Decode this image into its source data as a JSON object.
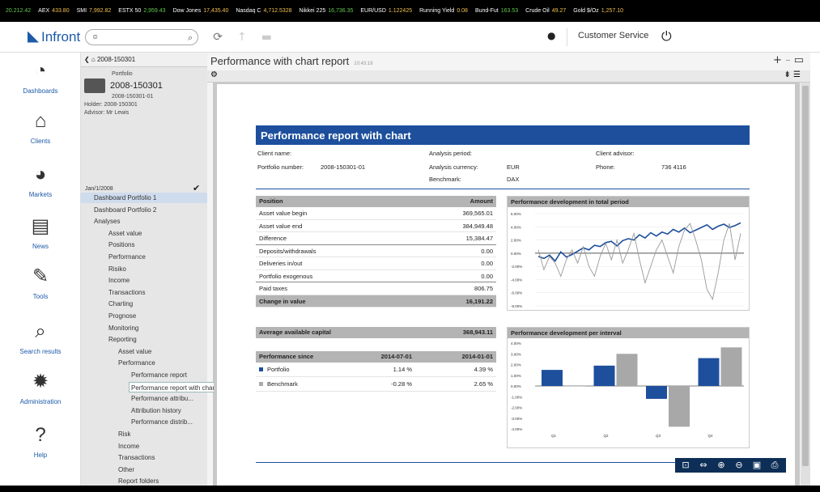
{
  "ticker": [
    {
      "name": "",
      "value": "20.212.42"
    },
    {
      "name": "AEX",
      "value": "433.80"
    },
    {
      "name": "SMI",
      "value": "7,992.82"
    },
    {
      "name": "ESTX 50",
      "value": "2,959.43"
    },
    {
      "name": "Dow Jones",
      "value": "17,435.40"
    },
    {
      "name": "Nasdaq C",
      "value": "4,712.5328"
    },
    {
      "name": "Nikkei 225",
      "value": "16,736.35"
    },
    {
      "name": "EUR/USD",
      "value": "1.122425"
    },
    {
      "name": "Running Yield",
      "value": "0.08"
    },
    {
      "name": "Bund-Fut",
      "value": "163.53"
    },
    {
      "name": "Crude Oil",
      "value": "49.27"
    },
    {
      "name": "Gold $/Oz",
      "value": "1,257.10"
    }
  ],
  "header": {
    "brand": "Infront",
    "search_placeholder": "",
    "customer_service": "Customer Service"
  },
  "rail": [
    "Dashboards",
    "Clients",
    "Markets",
    "News",
    "Tools",
    "Search results",
    "Administration",
    "Help"
  ],
  "tree": {
    "back_label": "2008-150301",
    "portfolio_label": "Portfolio",
    "portfolio_name": "2008-150301",
    "portfolio_id": "2008-150301-01",
    "holder": "Holder: 2008-150301",
    "advisor": "Advisor: Mr Lewis",
    "date": "Jan/1/2008",
    "nodes": [
      {
        "label": "Dashboard Portfolio 1",
        "indent": 16,
        "sel": true
      },
      {
        "label": "Dashboard Portfolio 2",
        "indent": 16
      },
      {
        "label": "Analyses",
        "indent": 16
      },
      {
        "label": "Asset value",
        "indent": 34
      },
      {
        "label": "Positions",
        "indent": 34
      },
      {
        "label": "Performance",
        "indent": 34
      },
      {
        "label": "Risiko",
        "indent": 34
      },
      {
        "label": "Income",
        "indent": 34
      },
      {
        "label": "Transactions",
        "indent": 34
      },
      {
        "label": "Charting",
        "indent": 34
      },
      {
        "label": "Prognose",
        "indent": 34
      },
      {
        "label": "Monitoring",
        "indent": 34
      },
      {
        "label": "Reporting",
        "indent": 34
      },
      {
        "label": "Asset value",
        "indent": 46
      },
      {
        "label": "Performance",
        "indent": 46
      },
      {
        "label": "Performance report",
        "indent": 62
      },
      {
        "label": "Performance report with chart",
        "indent": 62,
        "hi": true
      },
      {
        "label": "Performance attribu...",
        "indent": 62
      },
      {
        "label": "Attribution history",
        "indent": 62
      },
      {
        "label": "Performance distrib...",
        "indent": 62
      },
      {
        "label": "Risk",
        "indent": 46
      },
      {
        "label": "Income",
        "indent": 46
      },
      {
        "label": "Transactions",
        "indent": 46
      },
      {
        "label": "Other",
        "indent": 46
      },
      {
        "label": "Report folders",
        "indent": 46
      }
    ]
  },
  "main": {
    "title": "Performance with chart report",
    "timestamp": "10:43:18"
  },
  "report": {
    "title": "Performance report with chart",
    "client_name_label": "Client name:",
    "portfolio_number_label": "Portfolio number:",
    "portfolio_number": "2008-150301-01",
    "analysis_period_label": "Analysis period:",
    "analysis_currency_label": "Analysis currency:",
    "analysis_currency": "EUR",
    "benchmark_label": "Benchmark:",
    "benchmark": "DAX",
    "client_advisor_label": "Client advisor:",
    "phone_label": "Phone:",
    "phone": "736 4116",
    "position_header": "Position",
    "amount_header": "Amount",
    "rows": [
      {
        "label": "Asset value begin",
        "value": "369,565.01"
      },
      {
        "label": "Asset value end",
        "value": "384,949.48"
      },
      {
        "label": "Difference",
        "value": "15,384.47"
      },
      {
        "label": "Deposits/withdrawals",
        "value": "0.00"
      },
      {
        "label": "Deliveries in/out",
        "value": "0.00"
      },
      {
        "label": "Portfolio exogenous",
        "value": "0.00"
      },
      {
        "label": "Paid taxes",
        "value": "806.75"
      }
    ],
    "change_label": "Change in value",
    "change_value": "16,191.22",
    "avg_label": "Average available capital",
    "avg_value": "368,943.11",
    "since_label": "Performance since",
    "since_col1": "2014-07-01",
    "since_col2": "2014-01-01",
    "perf_rows": [
      {
        "label": "Portfolio",
        "v1": "1.14 %",
        "v2": "4.39 %",
        "color": "#1d4f9c"
      },
      {
        "label": "Benchmark",
        "v1": "-0.28 %",
        "v2": "2.65 %",
        "color": "#aaaaaa"
      }
    ]
  },
  "chart_data": [
    {
      "type": "line",
      "title": "Performance development in total period",
      "y_ticks": [
        "6.00%",
        "4.00%",
        "2.00%",
        "0.00%",
        "-2.00%",
        "-4.00%",
        "-6.00%",
        "-8.00%"
      ],
      "ylim": [
        -8,
        6
      ],
      "series": [
        {
          "color": "#1d4f9c",
          "values": [
            -0.5,
            -0.8,
            -0.3,
            -1.2,
            0.2,
            -0.6,
            -0.2,
            0.3,
            0.8,
            0.5,
            1.2,
            1.0,
            1.6,
            1.8,
            1.1,
            1.9,
            2.2,
            2.0,
            2.8,
            2.3,
            3.1,
            2.6,
            3.2,
            2.9,
            3.6,
            3.2,
            3.8,
            3.1,
            3.5,
            3.9,
            4.3,
            3.6,
            4.1,
            4.4,
            3.9,
            4.2,
            4.6
          ]
        },
        {
          "color": "#999999",
          "values": [
            0.5,
            -2.5,
            -0.5,
            -1.5,
            -3.5,
            -1.0,
            0.5,
            -1.5,
            1.0,
            -2.0,
            -3.5,
            -0.5,
            1.5,
            -1.0,
            2.0,
            -1.5,
            0.5,
            3.0,
            -1.0,
            -4.5,
            -2.0,
            0.5,
            2.0,
            -0.5,
            -3.0,
            1.0,
            3.5,
            4.5,
            2.0,
            -1.0,
            -5.5,
            -7.0,
            -3.0,
            2.0,
            4.5,
            -1.0,
            3.0
          ]
        }
      ]
    },
    {
      "type": "bar",
      "title": "Performance development per interval",
      "categories": [
        "Q1",
        "Q2",
        "Q3",
        "Q4"
      ],
      "y_ticks": [
        "4.00%",
        "3.00%",
        "2.00%",
        "1.00%",
        "0.00%",
        "-1.00%",
        "-2.00%",
        "-3.00%",
        "-4.00%"
      ],
      "ylim": [
        -4,
        4
      ],
      "series": [
        {
          "color": "#1d4f9c",
          "values": [
            1.5,
            1.9,
            -1.2,
            2.6
          ]
        },
        {
          "color": "#a8a8a8",
          "values": [
            0.0,
            3.0,
            -3.8,
            3.6
          ]
        }
      ]
    }
  ]
}
